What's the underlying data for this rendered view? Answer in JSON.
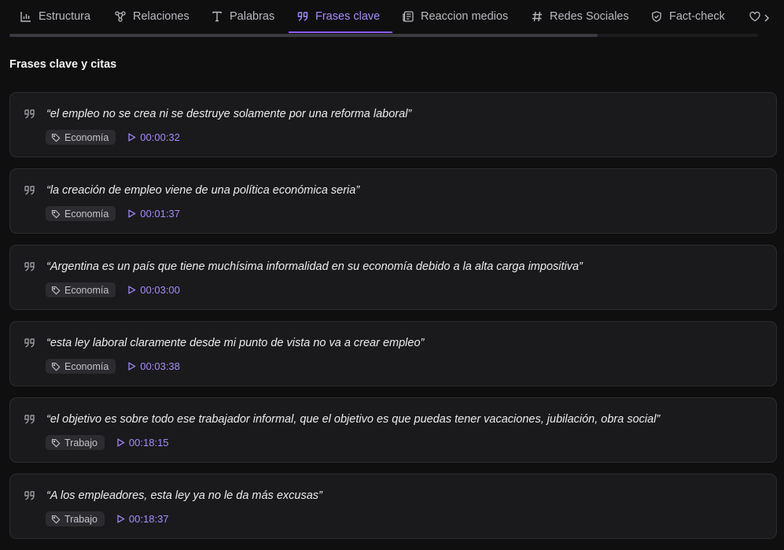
{
  "tabs": [
    {
      "label": "Estructura",
      "icon": "bar-chart-icon"
    },
    {
      "label": "Relaciones",
      "icon": "network-icon"
    },
    {
      "label": "Palabras",
      "icon": "type-icon"
    },
    {
      "label": "Frases clave",
      "icon": "quote-icon",
      "active": true
    },
    {
      "label": "Reaccion medios",
      "icon": "newspaper-icon"
    },
    {
      "label": "Redes Sociales",
      "icon": "hash-icon"
    },
    {
      "label": "Fact-check",
      "icon": "shield-check-icon"
    }
  ],
  "section": {
    "title": "Frases clave y citas"
  },
  "quotes": [
    {
      "text": "“el empleo no se crea ni se destruye solamente por una reforma laboral”",
      "tag": "Economía",
      "time": "00:00:32"
    },
    {
      "text": "“la creación de empleo viene de una política económica seria”",
      "tag": "Economía",
      "time": "00:01:37"
    },
    {
      "text": "“Argentina es un país que tiene muchísima informalidad en su economía debido a la alta carga impositiva”",
      "tag": "Economía",
      "time": "00:03:00"
    },
    {
      "text": "“esta ley laboral claramente desde mi punto de vista no va a crear empleo”",
      "tag": "Economía",
      "time": "00:03:38"
    },
    {
      "text": "“el objetivo es sobre todo ese trabajador informal, que el objetivo es que puedas tener vacaciones, jubilación, obra social”",
      "tag": "Trabajo",
      "time": "00:18:15"
    },
    {
      "text": "“A los empleadores, esta ley ya no le da más excusas”",
      "tag": "Trabajo",
      "time": "00:18:37"
    }
  ],
  "colors": {
    "accent": "#a78bfa",
    "background": "#0f0f10",
    "card": "#1a1a1c"
  }
}
